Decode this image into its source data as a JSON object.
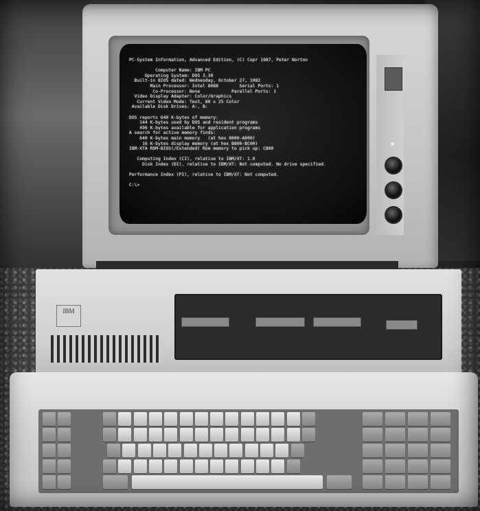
{
  "scene": {
    "subject": "vintage-personal-computer",
    "monochrome": true
  },
  "system_unit": {
    "logo_text": "IBM"
  },
  "screen": {
    "lines": [
      "PC-System Information, Advanced Edition, (C) Copr 1987, Peter Norton",
      "",
      "          Computer Name: IBM PC",
      "      Operating System: DOS 3.30",
      "  Built-in BIOS dated: Wednesday, October 27, 1982",
      "        Main Processor: Intel 8088        Serial Ports: 1",
      "         Co-Processor: None            Parallel Ports: 1",
      "  Video Display Adapter: Color/Graphics",
      "   Current Video Mode: Text, 80 x 25 Color",
      " Available Disk Drives: A:, B:",
      "",
      "DOS reports 640 K-bytes of memory:",
      "    144 K-bytes used by DOS and resident programs",
      "    496 K-bytes available for application programs",
      "A search for active memory finds:",
      "    640 K-bytes main memory   (at hex 0000-A000)",
      "     16 K-bytes display memory (at hex B800-BC00)",
      "IBM-XTA ROM-BIOS(/Extended) Rom memory to pick up: C800",
      "",
      "   Computing Index (CI), relative to IBM/XT: 1.0",
      "     Disk Index (DI), relative to IBM/XT: Not computed. No drive specified.",
      "",
      "Performance Index (PI), relative to IBM/XT: Not computed.",
      "",
      "C:\\>"
    ]
  }
}
